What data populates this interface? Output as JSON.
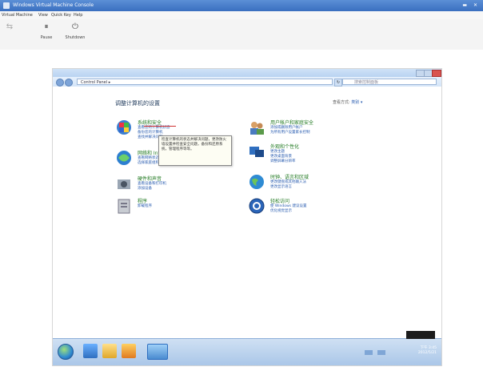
{
  "vm": {
    "title": "Windows Virtual Machine Console",
    "menu": [
      "Virtual Machine",
      "View",
      "Quick Key",
      "Help"
    ],
    "toolbar": [
      {
        "label": "Pause",
        "icon": "pause-icon"
      },
      {
        "label": "Shutdown",
        "icon": "power-icon"
      }
    ]
  },
  "cp": {
    "address": "Control Panel ▸",
    "search_placeholder": "搜索控制面板",
    "heading": "调整计算机的设置",
    "view_by_label": "查看方式:",
    "view_by_value": "类别 ▾",
    "categories_left": [
      {
        "title": "系统和安全",
        "icon": "shield-icon",
        "links": [
          "查看您的计算机状态",
          "备份您的计算机",
          "查找并解决问题"
        ]
      },
      {
        "title": "网络和 Internet",
        "icon": "network-icon",
        "links": [
          "查看网络状态和任务",
          "选择家庭组和共享选项"
        ]
      },
      {
        "title": "硬件和声音",
        "icon": "speaker-icon",
        "links": [
          "查看设备和打印机",
          "添加设备"
        ]
      },
      {
        "title": "程序",
        "icon": "programs-icon",
        "links": [
          "卸载程序"
        ]
      }
    ],
    "categories_right": [
      {
        "title": "用户帐户和家庭安全",
        "icon": "users-icon",
        "links": [
          "添加或删除用户帐户",
          "为所有用户设置家长控制"
        ]
      },
      {
        "title": "外观和个性化",
        "icon": "appearance-icon",
        "links": [
          "更改主题",
          "更改桌面背景",
          "调整屏幕分辨率"
        ]
      },
      {
        "title": "时钟、语言和区域",
        "icon": "globe-icon",
        "links": [
          "更改键盘或其他输入法",
          "更改显示语言"
        ]
      },
      {
        "title": "轻松访问",
        "icon": "ease-icon",
        "links": [
          "使 Windows 建议设置",
          "优化视觉显示"
        ]
      }
    ],
    "tooltip": "检查计算机的状态并解决问题，更改防火墙设置并检查安全问题，备份和还原系统，管理程序等等。"
  },
  "taskbar": {
    "clock_time": "下午 3:45",
    "clock_date": "2012/5/21"
  },
  "colors": {
    "title_bar": "#3a6fc0",
    "category_title": "#217a21",
    "link": "#2a5db0"
  }
}
